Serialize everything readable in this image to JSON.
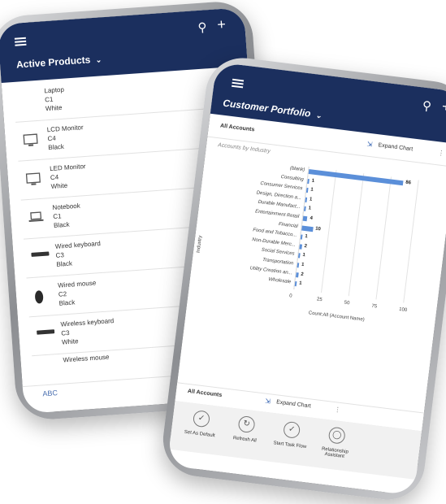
{
  "left_app": {
    "title": "Active Products",
    "items": [
      {
        "name": "Laptop",
        "code": "C1",
        "color": "White",
        "more": "..."
      },
      {
        "name": "LCD Monitor",
        "code": "C4",
        "color": "Black",
        "more": "..."
      },
      {
        "name": "LED Monitor",
        "code": "C4",
        "color": "White",
        "more": "..."
      },
      {
        "name": "Notebook",
        "code": "C1",
        "color": "Black",
        "more": "..."
      },
      {
        "name": "Wired keyboard",
        "code": "C3",
        "color": "Black",
        "more": "..."
      },
      {
        "name": "Wired mouse",
        "code": "C2",
        "color": "Black",
        "more": "..."
      },
      {
        "name": "Wireless keyboard",
        "code": "C3",
        "color": "White",
        "more": "..."
      },
      {
        "name": "Wireless mouse",
        "code": "",
        "color": "",
        "more": ""
      }
    ],
    "footer": "ABC",
    "icons": {
      "menu": "hamburger-icon",
      "search": "search-icon",
      "add": "plus-icon"
    },
    "accent": "#1b2f5e"
  },
  "right_app": {
    "title": "Customer Portfolio",
    "view_label": "All Accounts",
    "expand_label": "Expand Chart",
    "chart_title": "Accounts by Industry",
    "bottom_view_label": "All Accounts",
    "bottom_expand_label": "Expand Chart",
    "more": "⋮",
    "actions": [
      {
        "label": "Set As Default",
        "icon": "checkmark-icon"
      },
      {
        "label": "Refresh All",
        "icon": "refresh-icon"
      },
      {
        "label": "Start Task Flow",
        "icon": "task-flow-icon"
      },
      {
        "label": "Relationship Assistant",
        "icon": "lightbulb-icon"
      }
    ],
    "accent": "#1b2f5e",
    "bar_color": "#5b8fd9"
  },
  "chart_data": {
    "type": "bar",
    "orientation": "horizontal",
    "title": "Accounts by Industry",
    "xlabel": "Count:All (Account Name)",
    "ylabel": "Industry",
    "categories": [
      "(blank)",
      "Consulting",
      "Consumer Services",
      "Design, Direction a...",
      "Durable Manufact...",
      "Entertainment Retail",
      "Financial",
      "Food and Tobacco...",
      "Non-Durable Merc...",
      "Social Services",
      "Transportation",
      "Utility Creation an...",
      "Wholesale"
    ],
    "values": [
      86,
      1,
      1,
      1,
      1,
      4,
      10,
      1,
      2,
      1,
      1,
      2,
      1
    ],
    "xticks": [
      "0",
      "25",
      "50",
      "75",
      "100"
    ],
    "xlim": [
      0,
      100
    ],
    "grid": true
  }
}
